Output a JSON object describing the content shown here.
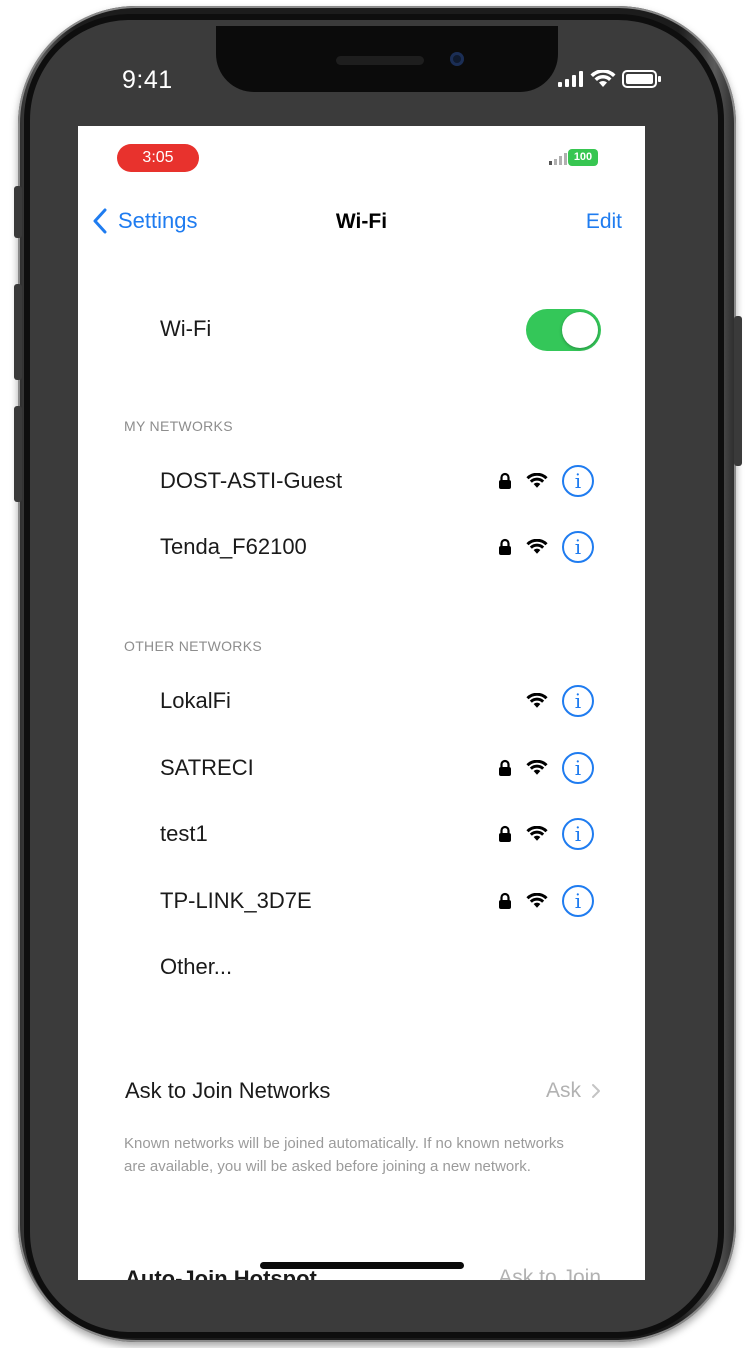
{
  "device": {
    "time": "9:41"
  },
  "status_bar": {
    "time": "3:05",
    "battery": "100"
  },
  "nav": {
    "back_label": "Settings",
    "title": "Wi-Fi",
    "edit_label": "Edit"
  },
  "wifi_toggle": {
    "label": "Wi-Fi",
    "enabled": true
  },
  "my_networks": {
    "header": "MY NETWORKS",
    "items": [
      {
        "name": "DOST-ASTI-Guest",
        "secured": true
      },
      {
        "name": "Tenda_F62100",
        "secured": true
      }
    ]
  },
  "other_networks": {
    "header": "OTHER NETWORKS",
    "items": [
      {
        "name": "LokalFi",
        "secured": false
      },
      {
        "name": "SATRECI",
        "secured": true
      },
      {
        "name": "test1",
        "secured": true
      },
      {
        "name": "TP-LINK_3D7E",
        "secured": true
      }
    ],
    "other_label": "Other..."
  },
  "ask_to_join": {
    "label": "Ask to Join Networks",
    "value": "Ask",
    "footnote": "Known networks will be joined automatically. If no known networks are available, you will be asked before joining a new network."
  },
  "auto_join_hotspot": {
    "label": "Auto-Join Hotspot",
    "value": "Ask to Join"
  },
  "icons": {
    "lock": "lock-icon",
    "wifi": "wifi-icon",
    "info": "info-icon",
    "chevron_left": "chevron-left-icon",
    "chevron_right": "chevron-right-icon"
  },
  "colors": {
    "accent_blue": "#1f7cf0",
    "toggle_green": "#34c759",
    "recording_red": "#e8322d"
  }
}
